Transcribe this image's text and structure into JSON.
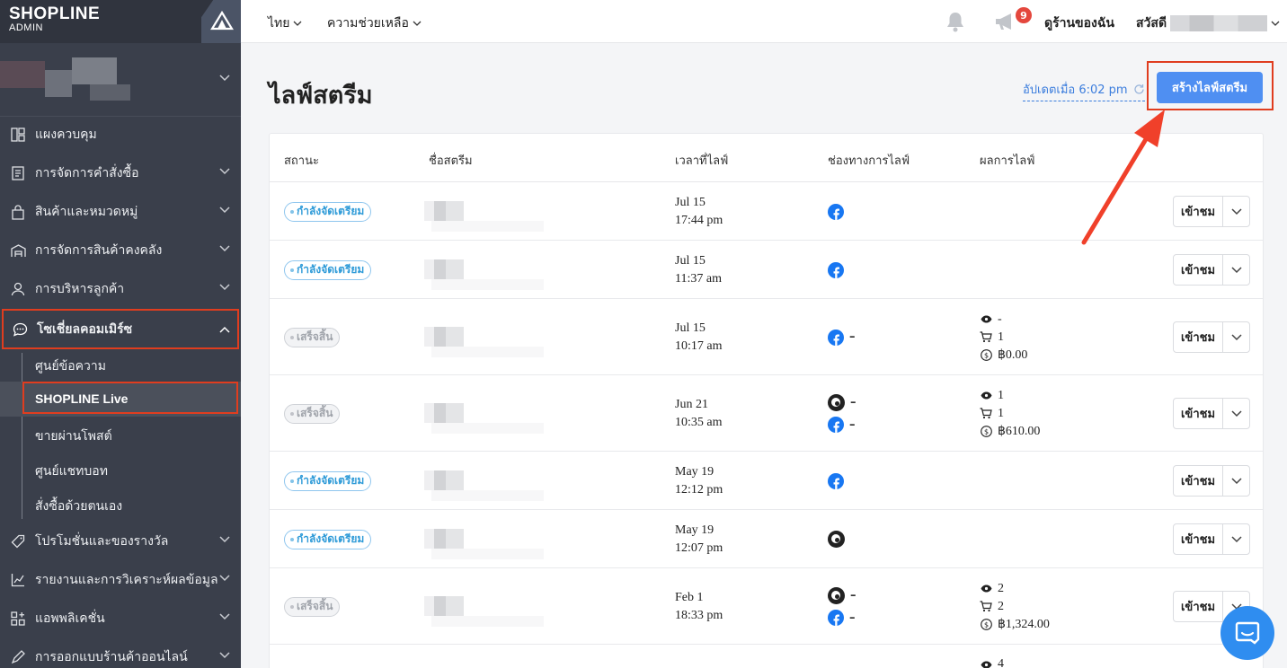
{
  "sidebar": {
    "logo": {
      "title": "SHOPLINE",
      "subtitle": "ADMIN"
    },
    "nav": [
      {
        "label": "แผงควบคุม",
        "icon": "dashboard-icon"
      },
      {
        "label": "การจัดการคำสั่งซื้อ",
        "icon": "orders-icon"
      },
      {
        "label": "สินค้าและหมวดหมู่",
        "icon": "shopping-bag-icon"
      },
      {
        "label": "การจัดการสินค้าคงคลัง",
        "icon": "warehouse-icon"
      },
      {
        "label": "การบริหารลูกค้า",
        "icon": "user-icon"
      },
      {
        "label": "โซเชี่ยลคอมเมิร์ซ",
        "icon": "chat-bubble-icon"
      },
      {
        "label": "โปรโมชั่นและของรางวัล",
        "icon": "tag-icon"
      },
      {
        "label": "รายงานและการวิเคราะห์ผลข้อมูล",
        "icon": "chart-icon"
      },
      {
        "label": "แอพพลิเคชั่น",
        "icon": "apps-icon"
      },
      {
        "label": "การออกแบบร้านค้าออนไลน์",
        "icon": "design-icon"
      }
    ],
    "social_sub": [
      "ศูนย์ข้อความ",
      "SHOPLINE Live",
      "ขายผ่านโพสต์",
      "ศูนย์แชทบอท",
      "สั่งซื้อด้วยตนเอง"
    ]
  },
  "topbar": {
    "language": "ไทย",
    "help": "ความช่วยเหลือ",
    "notification_count": "9",
    "view_store": "ดูร้านของฉัน",
    "greeting": "สวัสดี"
  },
  "page": {
    "title": "ไลฟ์สตรีม",
    "updated": "อัปเดตเมื่อ 6:02 pm",
    "create_button": "สร้างไลฟ์สตรีม"
  },
  "table": {
    "headers": [
      "สถานะ",
      "ชื่อสตรีม",
      "เวลาที่ไลฟ์",
      "ช่องทางการไลฟ์",
      "ผลการไลฟ์"
    ],
    "view_label": "เข้าชม",
    "rows": [
      {
        "status": "กำลังจัดเตรียม",
        "kind": "prep",
        "date": "Jul 15",
        "time": "17:44 pm",
        "channels": [
          {
            "type": "facebook",
            "dash": ""
          }
        ],
        "stats": null
      },
      {
        "status": "กำลังจัดเตรียม",
        "kind": "prep",
        "date": "Jul 15",
        "time": "11:37 am",
        "channels": [
          {
            "type": "facebook",
            "dash": ""
          }
        ],
        "stats": null
      },
      {
        "status": "เสร็จสิ้น",
        "kind": "done",
        "date": "Jul 15",
        "time": "10:17 am",
        "channels": [
          {
            "type": "facebook",
            "dash": "–"
          }
        ],
        "stats": {
          "views": "-",
          "carts": "1",
          "sales": "฿0.00"
        }
      },
      {
        "status": "เสร็จสิ้น",
        "kind": "done",
        "date": "Jun 21",
        "time": "10:35 am",
        "channels": [
          {
            "type": "instagram",
            "dash": "–"
          },
          {
            "type": "facebook",
            "dash": "–"
          }
        ],
        "stats": {
          "views": "1",
          "carts": "1",
          "sales": "฿610.00"
        }
      },
      {
        "status": "กำลังจัดเตรียม",
        "kind": "prep",
        "date": "May 19",
        "time": "12:12 pm",
        "channels": [
          {
            "type": "facebook",
            "dash": ""
          }
        ],
        "stats": null
      },
      {
        "status": "กำลังจัดเตรียม",
        "kind": "prep",
        "date": "May 19",
        "time": "12:07 pm",
        "channels": [
          {
            "type": "instagram",
            "dash": ""
          }
        ],
        "stats": null
      },
      {
        "status": "เสร็จสิ้น",
        "kind": "done",
        "date": "Feb 1",
        "time": "18:33 pm",
        "channels": [
          {
            "type": "instagram",
            "dash": "–"
          },
          {
            "type": "facebook",
            "dash": "–"
          }
        ],
        "stats": {
          "views": "2",
          "carts": "2",
          "sales": "฿1,324.00"
        }
      },
      {
        "status": "",
        "kind": "",
        "date": "",
        "time": "",
        "channels": [],
        "stats": {
          "views": "4",
          "carts": "",
          "sales": ""
        }
      }
    ]
  },
  "colors": {
    "accent": "#4f8ff2",
    "highlight": "#e03d1f",
    "sidebar": "#3a3f4b"
  }
}
